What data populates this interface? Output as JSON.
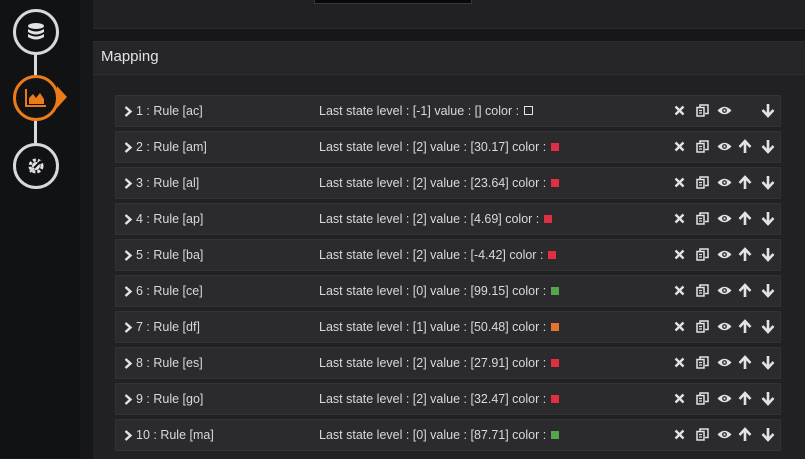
{
  "sidebar": {
    "steps": [
      {
        "icon": "database-icon",
        "active": false
      },
      {
        "icon": "chart-area-icon",
        "active": true
      },
      {
        "icon": "gear-tools-icon",
        "active": false
      }
    ],
    "accent": "#eb7b18"
  },
  "mapping": {
    "title": "Mapping",
    "rules": [
      {
        "name": "1 : Rule [ac]",
        "state": "Last state level : [-1]  value : []  color :",
        "color": null,
        "can_move_up": false
      },
      {
        "name": "2 : Rule [am]",
        "state": "Last state level : [2]  value : [30.17]  color :",
        "color": "#e02f44",
        "can_move_up": true
      },
      {
        "name": "3 : Rule [al]",
        "state": "Last state level : [2]  value : [23.64]  color :",
        "color": "#e02f44",
        "can_move_up": true
      },
      {
        "name": "4 : Rule [ap]",
        "state": "Last state level : [2]  value : [4.69]  color :",
        "color": "#e02f44",
        "can_move_up": true
      },
      {
        "name": "5 : Rule [ba]",
        "state": "Last state level : [2]  value : [-4.42]  color :",
        "color": "#e02f44",
        "can_move_up": true
      },
      {
        "name": "6 : Rule [ce]",
        "state": "Last state level : [0]  value : [99.15]  color :",
        "color": "#56a64b",
        "can_move_up": true
      },
      {
        "name": "7 : Rule [df]",
        "state": "Last state level : [1]  value : [50.48]  color :",
        "color": "#e0752d",
        "can_move_up": true
      },
      {
        "name": "8 : Rule [es]",
        "state": "Last state level : [2]  value : [27.91]  color :",
        "color": "#e02f44",
        "can_move_up": true
      },
      {
        "name": "9 : Rule [go]",
        "state": "Last state level : [2]  value : [32.47]  color :",
        "color": "#e02f44",
        "can_move_up": true
      },
      {
        "name": "10 : Rule [ma]",
        "state": "Last state level : [0]  value : [87.71]  color :",
        "color": "#56a64b",
        "can_move_up": true
      }
    ],
    "action_icons": [
      "remove-icon",
      "copy-icon",
      "eye-icon",
      "arrow-up-icon",
      "arrow-down-icon"
    ]
  }
}
